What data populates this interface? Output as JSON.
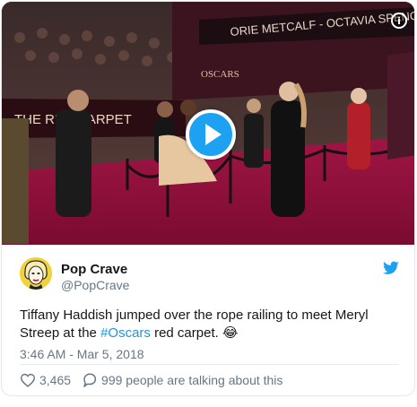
{
  "tweet": {
    "author": {
      "display_name": "Pop Crave",
      "handle": "@PopCrave",
      "avatar_icon": "avatar-marilyn-portrait"
    },
    "text_before": "Tiffany Haddish jumped over the rope railing to meet Meryl Streep at the ",
    "hashtag": "#Oscars",
    "text_after": " red carpet. ",
    "emoji": "😂",
    "timestamp": "3:46 AM - Mar 5, 2018",
    "likes": "3,465",
    "conversation": "999 people are talking about this"
  },
  "media": {
    "type": "video",
    "backdrop_texts": {
      "names_banner": "ORIE METCALF - OCTAVIA SPENCER",
      "oscars_sign": "OSCARS",
      "red_carpet": "THE RED CARPET"
    }
  },
  "icons": {
    "info": "info-icon",
    "play": "play-icon",
    "twitter": "twitter-bird-icon",
    "heart": "heart-icon",
    "reply": "speech-bubble-icon"
  },
  "colors": {
    "brand_blue": "#1da1f2",
    "hashtag_blue": "#1b95e0",
    "secondary_text": "#657786",
    "carpet_red": "#8e0e35"
  }
}
